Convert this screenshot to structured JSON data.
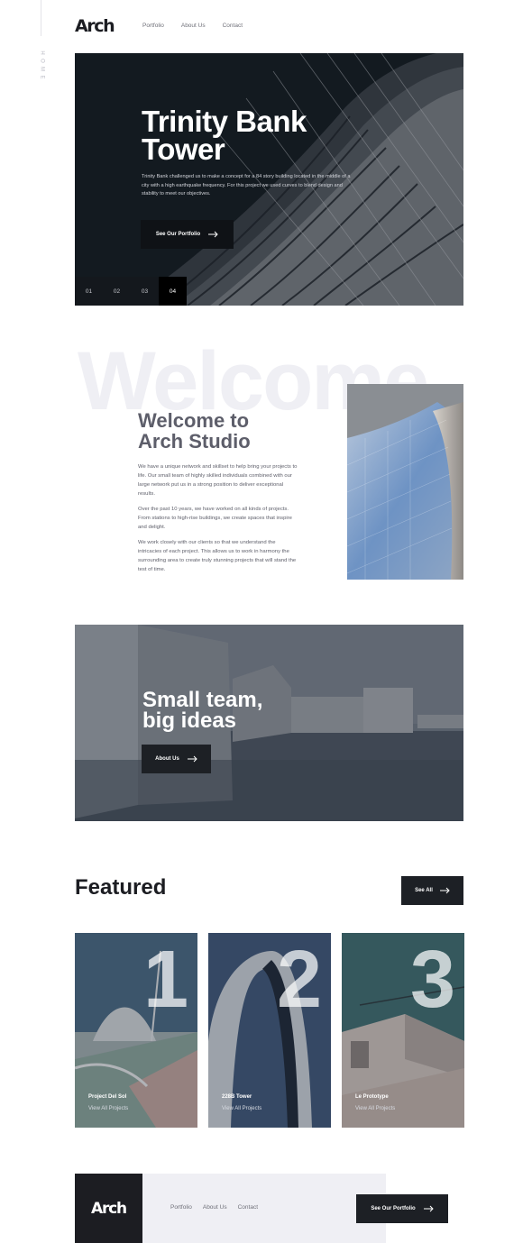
{
  "brand": {
    "logo": "Arch"
  },
  "nav": {
    "items": [
      "Portfolio",
      "About Us",
      "Contact"
    ]
  },
  "side": {
    "label": "HOME"
  },
  "hero": {
    "title_line1": "Trinity Bank",
    "title_line2": "Tower",
    "description": "Trinity Bank challenged us to make a concept for a 84 story building located in the middle of a city with a high earthquake frequency. For this project we used curves to blend design and stability to meet our objectives.",
    "button_label": "See Our Portfolio",
    "slides": [
      "01",
      "02",
      "03",
      "04"
    ],
    "active_slide": "04"
  },
  "welcome": {
    "watermark": "Welcome",
    "title_line1": "Welcome to",
    "title_line2": "Arch Studio",
    "paragraphs": [
      "We have a unique network and skillset to help bring your projects to life. Our small team of highly skilled individuals combined with our large network put us in a strong position to deliver exceptional results.",
      "Over the past 10 years, we have worked on all kinds of projects. From stations to high-rise buildings, we create spaces that inspire and delight.",
      "We work closely with our clients so that we understand the intricacies of each project. This allows us to work in harmony the surrounding area to create truly stunning projects that will stand the test of time."
    ]
  },
  "team": {
    "title_line1": "Small team,",
    "title_line2": "big ideas",
    "button_label": "About Us"
  },
  "featured": {
    "title": "Featured",
    "see_all_label": "See All",
    "cards": [
      {
        "number": "1",
        "name": "Project Del Sol",
        "link": "View All Projects"
      },
      {
        "number": "2",
        "name": "228B Tower",
        "link": "View All Projects"
      },
      {
        "number": "3",
        "name": "Le Prototype",
        "link": "View All Projects"
      }
    ]
  },
  "footer": {
    "logo": "Arch",
    "nav": [
      "Portfolio",
      "About Us",
      "Contact"
    ],
    "button_label": "See Our Portfolio"
  },
  "colors": {
    "dark": "#1c1d22",
    "light_gray": "#efeff4",
    "muted_text": "#6f7079"
  },
  "icons": {
    "button_arrow": "arrow-right-icon"
  }
}
